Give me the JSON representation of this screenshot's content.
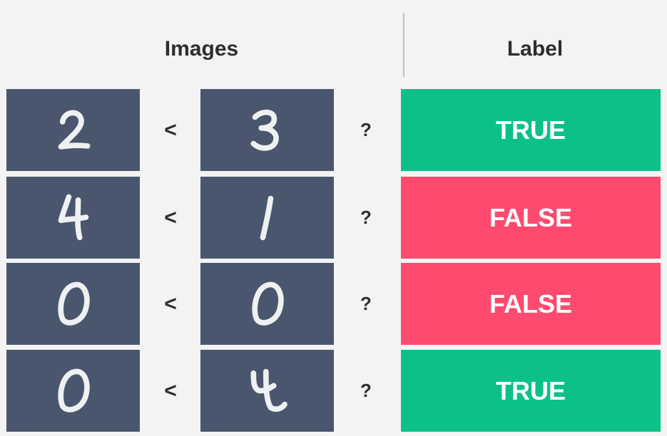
{
  "header": {
    "images": "Images",
    "label": "Label"
  },
  "colors": {
    "true_bg": "#0cc08a",
    "false_bg": "#fe4a6e",
    "tile_bg": "#4a566e"
  },
  "rows": [
    {
      "left_digit": "2",
      "operator": "<",
      "right_digit": "3",
      "question": "?",
      "label": "TRUE",
      "label_kind": "true"
    },
    {
      "left_digit": "4",
      "operator": "<",
      "right_digit": "1",
      "question": "?",
      "label": "FALSE",
      "label_kind": "false"
    },
    {
      "left_digit": "0",
      "operator": "<",
      "right_digit": "0",
      "question": "?",
      "label": "FALSE",
      "label_kind": "false"
    },
    {
      "left_digit": "0",
      "operator": "<",
      "right_digit": "4",
      "question": "?",
      "label": "TRUE",
      "label_kind": "true"
    }
  ]
}
